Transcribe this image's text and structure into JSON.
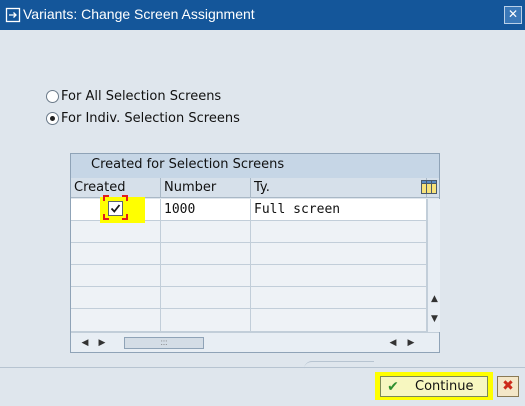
{
  "window": {
    "title": "Variants: Change Screen Assignment",
    "close_symbol": "✕",
    "title_icon": "dialog-arrow-icon"
  },
  "options": {
    "all_label": "For All Selection Screens",
    "indiv_label": "For Indiv. Selection Screens",
    "selected": "indiv"
  },
  "table": {
    "title": "Created for Selection Screens",
    "columns": [
      "Created",
      "Number",
      "Ty."
    ],
    "rows": [
      {
        "created": true,
        "number": "1000",
        "type": "Full screen"
      }
    ],
    "settings_icon": "column-settings-icon",
    "scroll_up": "▲",
    "scroll_down": "▼",
    "scroll_left": "◀",
    "scroll_right": "▶",
    "thumb_grip": ":::"
  },
  "footer": {
    "continue_label": "Continue",
    "continue_icon": "✔",
    "cancel_symbol": "✖"
  },
  "colors": {
    "titlebar": "#14569a",
    "highlight": "#ffff00",
    "focus_bracket": "#e21b1b"
  }
}
